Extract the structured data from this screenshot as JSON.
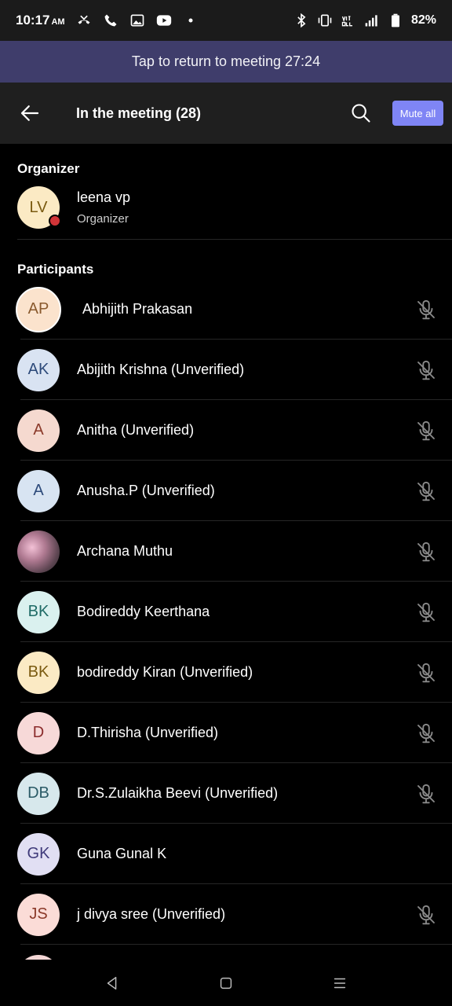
{
  "status_bar": {
    "time": "10:17",
    "ampm": "AM",
    "battery": "82%",
    "left_icons": [
      "missed-call-icon",
      "phone-icon",
      "gallery-icon",
      "youtube-icon",
      "dot-icon"
    ],
    "right_icons": [
      "bluetooth-icon",
      "vibrate-icon",
      "volte-icon",
      "signal-icon",
      "battery-icon"
    ]
  },
  "banner": {
    "text": "Tap to return to meeting 27:24"
  },
  "header": {
    "title": "In the meeting (28)",
    "mute_all_label": "Mute all"
  },
  "organizer_section": {
    "title": "Organizer",
    "name": "leena vp",
    "role": "Organizer",
    "initials": "LV",
    "avatar_bg": "#fbeac4",
    "avatar_fg": "#7a5a10",
    "presence_color": "#d13438"
  },
  "participants_section": {
    "title": "Participants",
    "items": [
      {
        "initials": "AP",
        "name": "Abhijith Prakasan",
        "bg": "#fbe3cd",
        "fg": "#8a5a2e",
        "muted": true
      },
      {
        "initials": "AK",
        "name": "Abijith Krishna  (Unverified)",
        "bg": "#d9e3f2",
        "fg": "#2d4a7a",
        "muted": true
      },
      {
        "initials": "A",
        "name": "Anitha  (Unverified)",
        "bg": "#f5d9cf",
        "fg": "#8b3a2a",
        "muted": true
      },
      {
        "initials": "A",
        "name": "Anusha.P (Unverified)",
        "bg": "#d8e4f2",
        "fg": "#2d4a7a",
        "muted": true
      },
      {
        "initials": "",
        "name": "Archana Muthu",
        "bg": "#8a6b74",
        "fg": "#ffffff",
        "muted": true,
        "photo": true
      },
      {
        "initials": "BK",
        "name": "Bodireddy Keerthana",
        "bg": "#daf1ef",
        "fg": "#1f6b66",
        "muted": true
      },
      {
        "initials": "BK",
        "name": "bodireddy Kiran  (Unverified)",
        "bg": "#fbeac4",
        "fg": "#7a5a10",
        "muted": true
      },
      {
        "initials": "D",
        "name": "D.Thirisha  (Unverified)",
        "bg": "#f7d9d8",
        "fg": "#8b2c2c",
        "muted": true
      },
      {
        "initials": "DB",
        "name": "Dr.S.Zulaikha Beevi (Unverified)",
        "bg": "#d7e8ec",
        "fg": "#2a5a66",
        "muted": true
      },
      {
        "initials": "GK",
        "name": "Guna Gunal K",
        "bg": "#e1dff3",
        "fg": "#3f3a7a",
        "muted": false
      },
      {
        "initials": "JS",
        "name": "j divya sree (Unverified)",
        "bg": "#fbdcd7",
        "fg": "#8b3a2a",
        "muted": true
      }
    ]
  },
  "nav_bar": {
    "icons": [
      "back-nav-icon",
      "home-nav-icon",
      "recents-nav-icon"
    ]
  }
}
